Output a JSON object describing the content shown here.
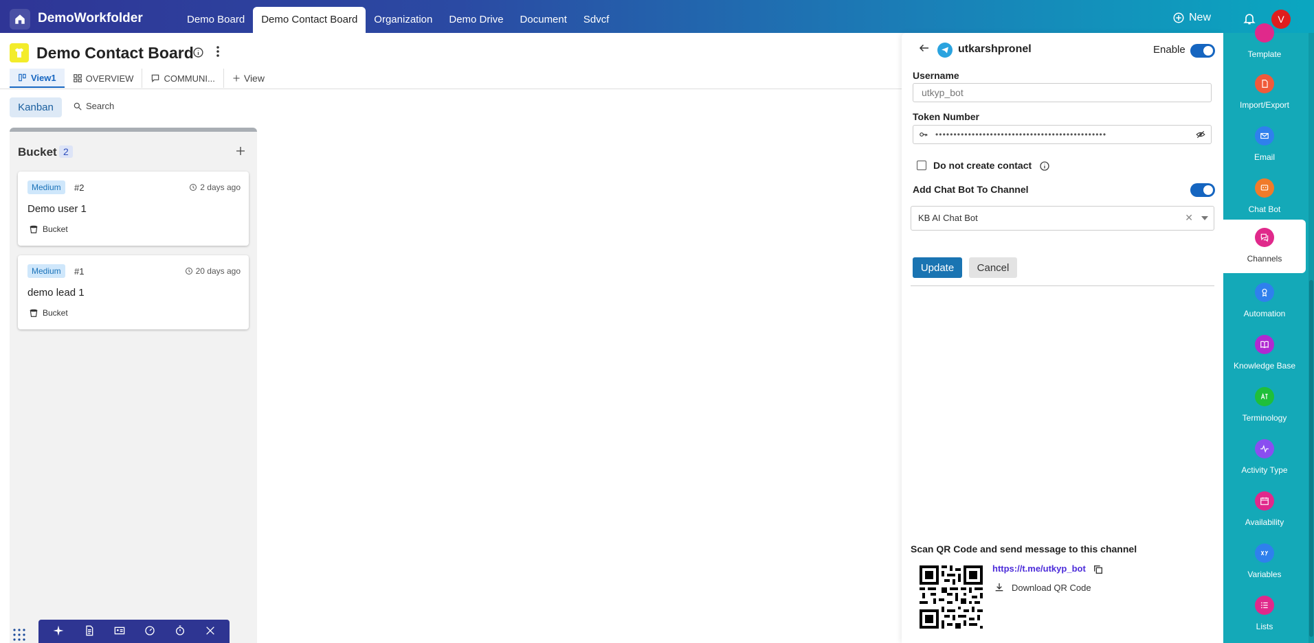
{
  "app": {
    "name": "DemoWorkfolder"
  },
  "nav": {
    "tabs": [
      {
        "label": "Demo Board"
      },
      {
        "label": "Demo Contact Board"
      },
      {
        "label": "Organization"
      },
      {
        "label": "Demo Drive"
      },
      {
        "label": "Document"
      },
      {
        "label": "Sdvcf"
      }
    ],
    "active_index": 1,
    "new_label": "New",
    "avatar_initial": "V"
  },
  "board": {
    "title": "Demo Contact Board",
    "views": [
      {
        "label": "View1",
        "icon": "kanban-view-icon"
      },
      {
        "label": "OVERVIEW",
        "icon": "grid-icon"
      },
      {
        "label": "COMMUNI...",
        "icon": "chat-icon"
      }
    ],
    "add_view_label": "View",
    "mode_label": "Kanban",
    "search_label": "Search"
  },
  "column": {
    "title": "Bucket",
    "count": "2",
    "cards": [
      {
        "priority": "Medium",
        "number": "#2",
        "time": "2 days ago",
        "name": "Demo user 1",
        "bucket": "Bucket"
      },
      {
        "priority": "Medium",
        "number": "#1",
        "time": "20 days ago",
        "name": "demo lead 1",
        "bucket": "Bucket"
      }
    ]
  },
  "panel": {
    "title": "utkarshpronel",
    "enable_label": "Enable",
    "enabled": true,
    "username_label": "Username",
    "username_value": "utkyp_bot",
    "token_label": "Token Number",
    "token_masked": "•••••••••••••••••••••••••••••••••••••••••••••••",
    "no_contact_label": "Do not create contact",
    "no_contact_checked": false,
    "chatbot_label": "Add Chat Bot To Channel",
    "chatbot_enabled": true,
    "chatbot_selected": "KB AI Chat Bot",
    "update_label": "Update",
    "cancel_label": "Cancel",
    "qr_heading": "Scan QR Code and send message to this channel",
    "qr_link": "https://t.me/utkyp_bot",
    "download_label": "Download QR Code"
  },
  "sidebar": {
    "items": [
      {
        "label": "Template",
        "icon": "template-icon",
        "color": "#e0298b"
      },
      {
        "label": "Import/Export",
        "icon": "import-export-icon",
        "color": "#f05a3a"
      },
      {
        "label": "Email",
        "icon": "email-icon",
        "color": "#2f80ed"
      },
      {
        "label": "Chat Bot",
        "icon": "chat-bot-icon",
        "color": "#f07b2a"
      },
      {
        "label": "Channels",
        "icon": "channels-icon",
        "color": "#e0298b"
      },
      {
        "label": "Automation",
        "icon": "automation-icon",
        "color": "#2f80ed"
      },
      {
        "label": "Knowledge Base",
        "icon": "knowledge-base-icon",
        "color": "#b02ad1"
      },
      {
        "label": "Terminology",
        "icon": "terminology-icon",
        "color": "#1fbf3a"
      },
      {
        "label": "Activity Type",
        "icon": "activity-type-icon",
        "color": "#8a4ef0"
      },
      {
        "label": "Availability",
        "icon": "availability-icon",
        "color": "#e0298b"
      },
      {
        "label": "Variables",
        "icon": "variables-icon",
        "color": "#2f80ed"
      },
      {
        "label": "Lists",
        "icon": "lists-icon",
        "color": "#e0298b"
      }
    ],
    "active_index": 4
  }
}
